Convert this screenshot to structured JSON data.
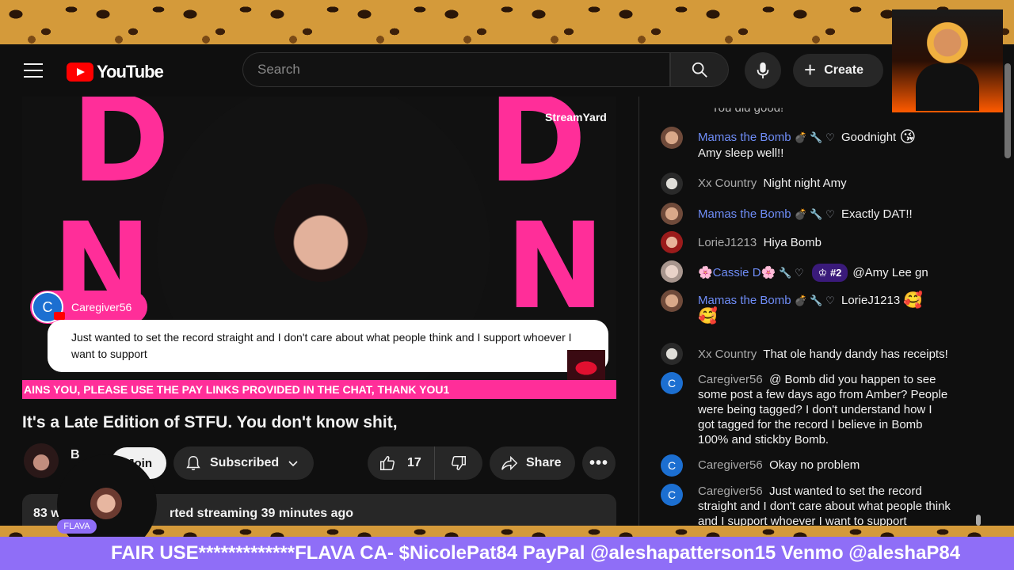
{
  "masthead": {
    "logo_text": "YouTube",
    "search_placeholder": "Search",
    "create_label": "Create"
  },
  "video": {
    "streamyard_label": "StreamYard",
    "letters": [
      "D",
      "D",
      "N",
      "N",
      "N"
    ],
    "featured_comment": {
      "avatar_letter": "C",
      "author": "Caregiver56",
      "text": "Just wanted to set the record straight and I don't care about what people think and I support whoever I want to support"
    },
    "ticker_text": "AINS YOU, PLEASE USE THE PAY LINKS PROVIDED IN THE CHAT, THANK YOU1"
  },
  "title": "It's a Late Edition of STFU. You don't know shit,",
  "channel": {
    "name": "B",
    "join_label": "Join",
    "subscribed_label": "Subscribed"
  },
  "actions": {
    "likes": "17",
    "share_label": "Share",
    "more_label": "•••"
  },
  "description": {
    "views": "83 w",
    "started": "rted streaming 39 minutes ago"
  },
  "overlay_guest": {
    "tag": "FLAVA"
  },
  "chat": {
    "fade_top": "You did good!",
    "messages": [
      {
        "author": "Mamas the Bomb",
        "badges": "💣 🔧 ♡",
        "text": "Goodnight 😘 Amy sleep well!!",
        "role": "mod"
      },
      {
        "author": "Xx Country",
        "badges": "",
        "text": "Night night Amy",
        "role": "plain"
      },
      {
        "author": "Mamas the Bomb",
        "badges": "💣 🔧 ♡",
        "text": "Exactly DAT!!",
        "role": "mod"
      },
      {
        "author": "LorieJ1213",
        "badges": "",
        "text": "Hiya Bomb",
        "role": "plain"
      },
      {
        "author": "🌸Cassie D🌸",
        "badges": "🔧 ♡",
        "gift": "#2",
        "text": "@Amy Lee gn",
        "role": "mod"
      },
      {
        "author": "Mamas the Bomb",
        "badges": "💣 🔧 ♡",
        "text": "LorieJ1213 🥰 🥰",
        "role": "mod"
      },
      {
        "author": "Xx Country",
        "badges": "",
        "text": "That ole handy dandy has receipts!",
        "role": "plain"
      },
      {
        "author": "Caregiver56",
        "badges": "",
        "text": "@ Bomb did you happen to see some post a few days ago from Amber? People were being tagged? I don't understand how I got tagged for the record I believe in Bomb 100% and stickby Bomb.",
        "role": "plain"
      },
      {
        "author": "Caregiver56",
        "badges": "",
        "text": "Okay no problem",
        "role": "plain"
      },
      {
        "author": "Caregiver56",
        "badges": "",
        "text": "Just wanted to set the record straight and I don't care about what people think and I support whoever I want to support",
        "role": "plain"
      }
    ],
    "avatar_letter": "C"
  },
  "bottom_banner": "FAIR USE*************FLAVA CA- $NicolePat84 PayPal @aleshapatterson15 Venmo @aleshaP84",
  "colors": {
    "brand_red": "#ff0000",
    "pink": "#ff2e99",
    "banner_purple": "#8f6ef7",
    "mod_blue": "#6f8df7"
  }
}
